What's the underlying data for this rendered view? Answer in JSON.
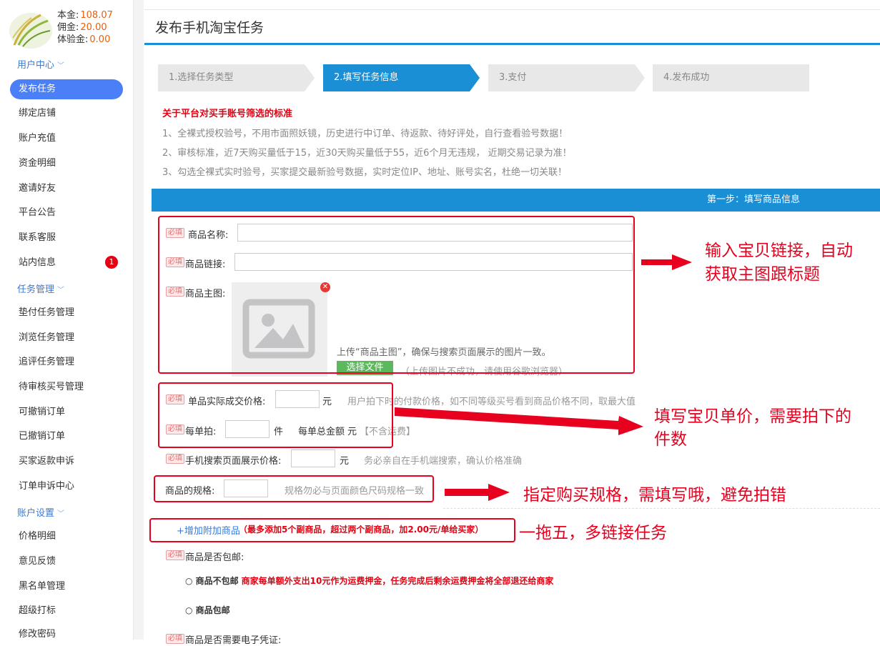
{
  "sidebar": {
    "balance": [
      {
        "label": "本金:",
        "value": "108.07"
      },
      {
        "label": "佣金:",
        "value": "20.00"
      },
      {
        "label": "体验金:",
        "value": "0.00"
      }
    ],
    "sections": {
      "user_center": "用户中心",
      "task_management": "任务管理",
      "account_settings": "账户设置"
    },
    "items": {
      "publish_task": "发布任务",
      "bind_shop": "绑定店铺",
      "recharge": "账户充值",
      "fund_details": "资金明细",
      "invite": "邀请好友",
      "announcement": "平台公告",
      "contact": "联系客服",
      "messages": "站内信息",
      "advance_task": "垫付任务管理",
      "browse_task": "浏览任务管理",
      "review_task": "追评任务管理",
      "pending_buyer": "待审核买号管理",
      "revocable": "可撤销订单",
      "revoked": "已撤销订单",
      "buyer_refund": "买家返款申诉",
      "order_appeal": "订单申诉中心",
      "price_detail": "价格明细",
      "feedback": "意见反馈",
      "blacklist": "黑名单管理",
      "super_boost": "超级打标",
      "change_password": "修改密码"
    },
    "messages_badge": "1"
  },
  "header": {
    "title": "发布手机淘宝任务"
  },
  "steps": [
    "1.选择任务类型",
    "2.填写任务信息",
    "3.支付",
    "4.发布成功"
  ],
  "standards": {
    "title": "关于平台对买手账号筛选的标准",
    "lines": [
      "1、全裸式授权验号，不用市面照妖镜，历史进行中订单、待返款、待好评处，自行查看验号数据！",
      "2、审核标准，近7天购买量低于15，近30天购买量低于55，近6个月无违规， 近期交易记录为准！",
      "3、勾选全裸式实时验号，买家提交最新验号数据，实时定位IP、地址、账号实名，杜绝一切关联！"
    ]
  },
  "step_bar": "第一步：填写商品信息",
  "form": {
    "required_tag": "必填",
    "product_name": "商品名称:",
    "product_link": "商品链接:",
    "product_image": "商品主图:",
    "image_hint": "上传“商品主图”，确保与搜索页面展示的图片一致。",
    "choose_file": "选择文件",
    "upload_fail_hint": "（上传图片不成功，请使用谷歌浏览器）",
    "unit_price": "单品实际成交价格:",
    "yuan": "元",
    "unit_price_hint": "用户拍下时的付款价格，如不同等级买号看到商品价格不同，取最大值",
    "per_order": "每单拍:",
    "piece": "件",
    "order_total": "每单总金额",
    "order_total_unit": "元",
    "no_shipping": "【不含运费】",
    "search_price": "手机搜索页面展示价格:",
    "search_price_unit": "元",
    "search_price_hint": "务必亲自在手机端搜索，确认价格准确",
    "spec": "商品的规格:",
    "spec_hint": "规格勿必与页面颜色尺码规格一致",
    "add_product": "+增加附加商品",
    "add_product_note": "（最多添加5个副商品，超过两个副商品，加2.00元/单给买家）",
    "free_shipping": "商品是否包邮:",
    "opt_no_free": "○ 商品不包邮",
    "opt_no_free_note": "商家每单额外支出10元作为运费押金，任务完成后剩余运费押金将全部退还给商家",
    "opt_free": "○ 商品包邮",
    "e_voucher": "商品是否需要电子凭证:"
  },
  "annotations": {
    "a1": "输入宝贝链接，自动",
    "a1b": "获取主图跟标题",
    "a2": "填写宝贝单价，需要拍下的",
    "a2b": "件数",
    "a3": "指定购买规格，需填写哦，避免拍错",
    "a4": "一拖五，多链接任务"
  },
  "colors": {
    "brand_blue": "#1a8fd6",
    "annotation_red": "#e8001f",
    "active_nav": "#4a7ff7"
  }
}
